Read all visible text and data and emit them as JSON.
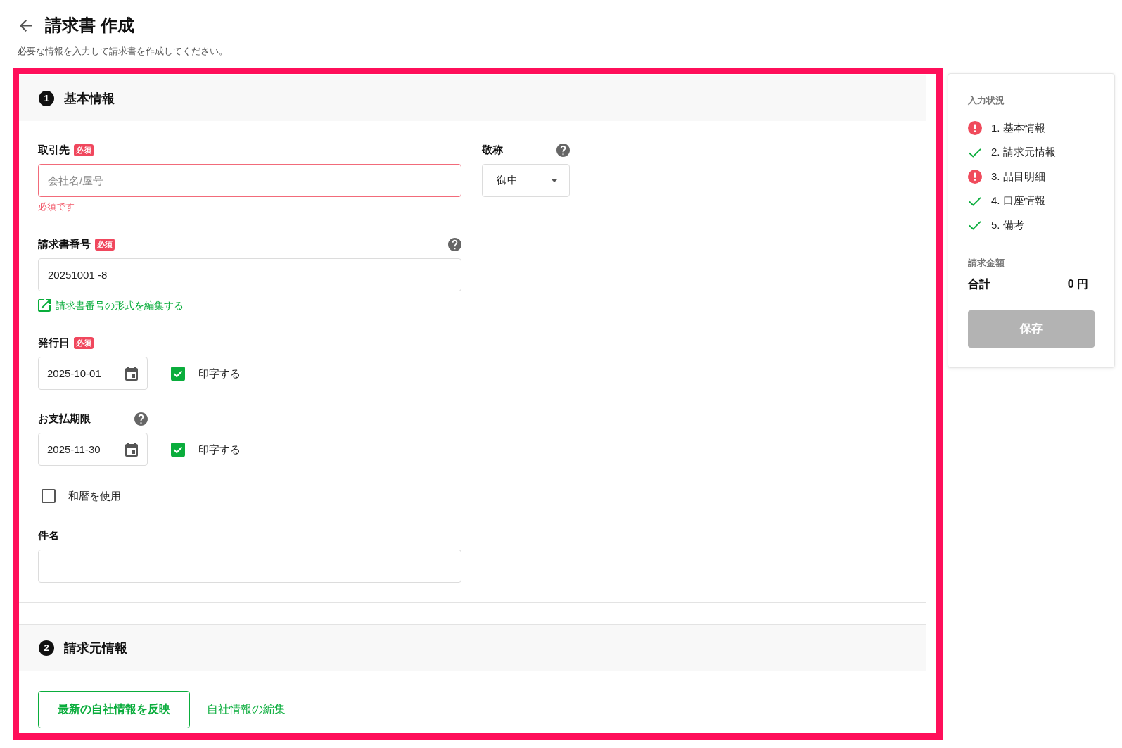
{
  "header": {
    "title": "請求書 作成",
    "subtitle": "必要な情報を入力して請求書を作成してください。"
  },
  "basic_info": {
    "number": "1",
    "title": "基本情報",
    "client": {
      "label": "取引先",
      "required_badge": "必須",
      "placeholder": "会社名/屋号",
      "error": "必須です"
    },
    "honorific": {
      "label": "敬称",
      "help": true,
      "value": "御中"
    },
    "invoice_number": {
      "label": "請求書番号",
      "required_badge": "必須",
      "help": true,
      "value": "20251001 -8",
      "link": "請求書番号の形式を編集する"
    },
    "issue_date": {
      "label": "発行日",
      "required_badge": "必須",
      "value": "2025-10-01",
      "print": {
        "label": "印字する",
        "checked": true
      }
    },
    "due_date": {
      "label": "お支払期限",
      "help": true,
      "value": "2025-11-30",
      "print": {
        "label": "印字する",
        "checked": true
      }
    },
    "japanese_era": {
      "label": "和暦を使用",
      "checked": false
    },
    "subject": {
      "label": "件名"
    }
  },
  "issuer_info": {
    "number": "2",
    "title": "請求元情報",
    "actions": [
      {
        "label": "最新の自社情報を反映",
        "kind": "outlined"
      },
      {
        "label": "自社情報の編集",
        "kind": "link"
      }
    ]
  },
  "progress": {
    "title": "入力状況",
    "items": [
      {
        "label": "1. 基本情報",
        "complete": false
      },
      {
        "label": "2. 請求元情報",
        "complete": true
      },
      {
        "label": "3. 品目明細",
        "complete": false
      },
      {
        "label": "4. 口座情報",
        "complete": true
      },
      {
        "label": "5. 備考",
        "complete": true
      }
    ]
  },
  "amount": {
    "title": "請求金額",
    "total_label": "合計",
    "total_value": "0 円"
  },
  "save_button": {
    "label": "保存",
    "disabled": true
  }
}
